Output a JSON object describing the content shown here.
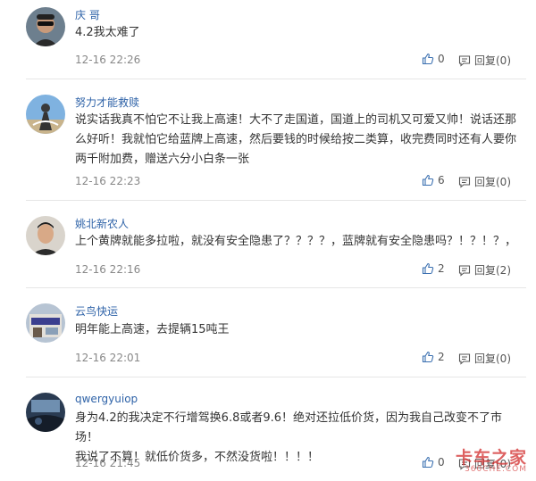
{
  "comments": [
    {
      "username": "庆 哥",
      "lines": [
        "4.2我太难了"
      ],
      "time": "12-16 22:26",
      "likes": "0",
      "reply": "回复(0)",
      "avatar_icon": "avatar-man-sunglasses"
    },
    {
      "username": "努力才能救赎",
      "lines": [
        "说实话我真不怕它不让我上高速！大不了走国道，国道上的司机又可爱又帅！说话还那",
        "么好听！我就怕它给蓝牌上高速，然后要钱的时候给按二类算，收完费同时还有人要你",
        "两千附加费，赠送六分小白条一张"
      ],
      "time": "12-16 22:23",
      "likes": "6",
      "reply": "回复(0)",
      "avatar_icon": "avatar-rider-sky"
    },
    {
      "username": "姚北新农人",
      "lines": [
        "上个黄牌就能多拉啦，就没有安全隐患了？？？？，蓝牌就有安全隐患吗？！？！？，"
      ],
      "time": "12-16 22:16",
      "likes": "2",
      "reply": "回复(2)",
      "avatar_icon": "avatar-man-portrait"
    },
    {
      "username": "云鸟快运",
      "lines": [
        "明年能上高速，去提辆15吨王"
      ],
      "time": "12-16 22:01",
      "likes": "2",
      "reply": "回复(0)",
      "avatar_icon": "avatar-storefront"
    },
    {
      "username": "qwergyuiop",
      "lines": [
        "身为4.2的我决定不行增驾换6.8或者9.6！绝对还拉低价货，因为我自己改变不了市场！",
        "我说了不算！就低价货多，不然没货啦！！！！"
      ],
      "time": "12-16 21:45",
      "likes": "0",
      "reply": "回复(0)",
      "avatar_icon": "avatar-car-interior"
    }
  ],
  "watermark": {
    "main": "卡车之家",
    "sub": "360CHE.COM"
  },
  "colors": {
    "username": "#2f63a8",
    "time": "#888888",
    "divider": "#e6e6e6"
  }
}
